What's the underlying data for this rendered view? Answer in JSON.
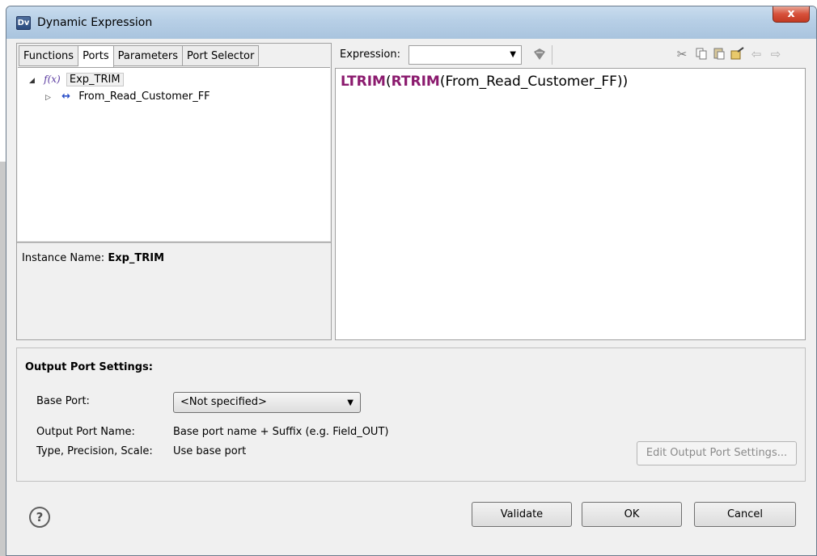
{
  "window": {
    "title": "Dynamic Expression",
    "app_icon_text": "Dv",
    "close_label": "x"
  },
  "left_panel": {
    "tabs": [
      {
        "label": "Functions"
      },
      {
        "label": "Ports"
      },
      {
        "label": "Parameters"
      },
      {
        "label": "Port Selector"
      }
    ],
    "active_tab": "Ports",
    "tree": {
      "root": {
        "icon": "function-icon",
        "icon_text": "f(x)",
        "label": "Exp_TRIM",
        "expanded": true
      },
      "child": {
        "icon": "port-arrow-icon",
        "icon_text": "↔",
        "label": "From_Read_Customer_FF",
        "expanded": false
      }
    },
    "instance_name_label": "Instance Name:",
    "instance_name_value": "Exp_TRIM"
  },
  "expression_panel": {
    "label": "Expression:",
    "combo_value": "",
    "toolbar_icons": [
      "filter-icon",
      "cut-icon",
      "copy-icon",
      "paste-icon",
      "format-icon",
      "undo-icon",
      "redo-icon"
    ],
    "expression": {
      "kw1": "LTRIM",
      "p1": "(",
      "kw2": "RTRIM",
      "rest": "(From_Read_Customer_FF))"
    }
  },
  "output_settings": {
    "title": "Output Port Settings:",
    "base_port_label": "Base Port:",
    "base_port_value": "<Not specified>",
    "output_port_name_label": "Output Port Name:",
    "output_port_name_value": "Base port name + Suffix (e.g. Field_OUT)",
    "type_label": "Type, Precision, Scale:",
    "type_value": "Use base port",
    "edit_button": "Edit Output Port Settings..."
  },
  "footer": {
    "help": "?",
    "validate": "Validate",
    "ok": "OK",
    "cancel": "Cancel"
  }
}
